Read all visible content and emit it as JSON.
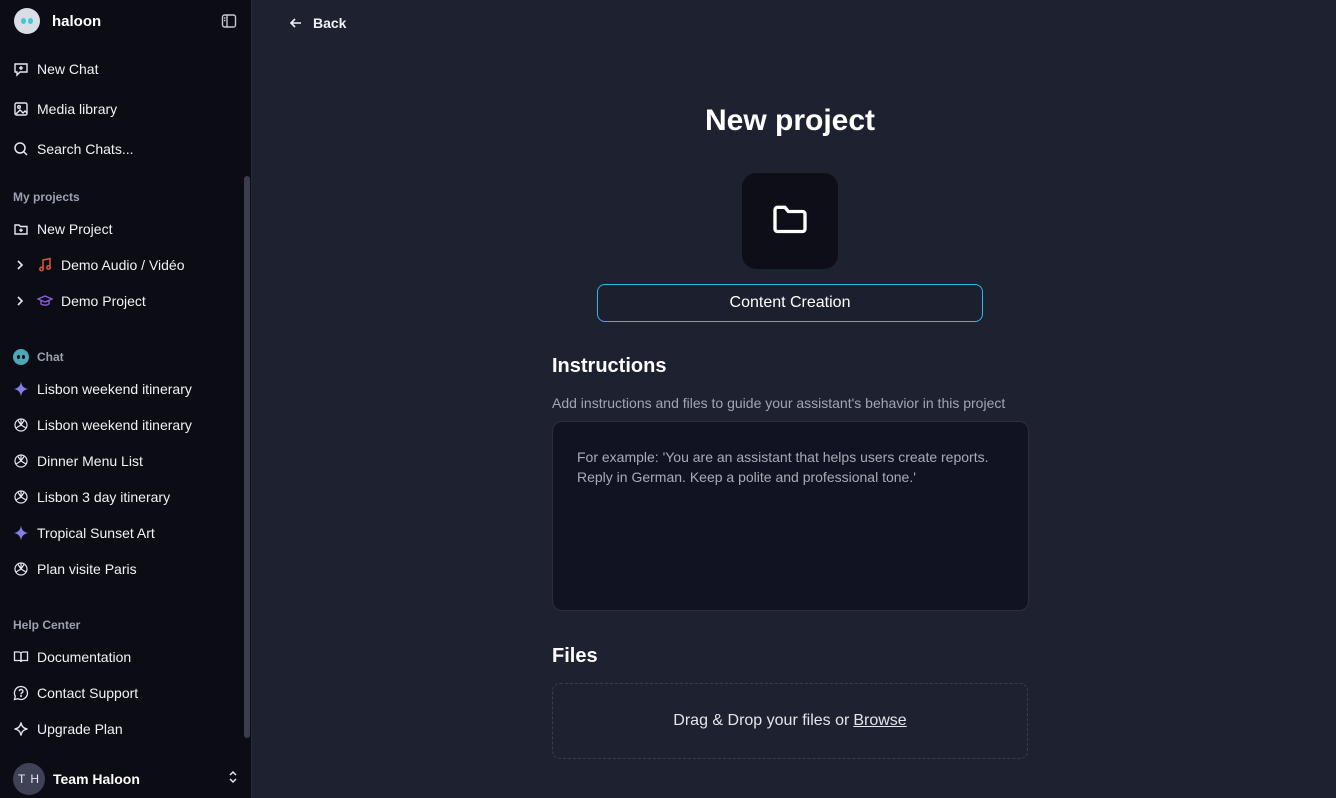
{
  "sidebar": {
    "brand_name": "haloon",
    "nav": {
      "new_chat": "New Chat",
      "media_library": "Media library",
      "search_chats": "Search Chats..."
    },
    "projects_label": "My projects",
    "new_project": "New Project",
    "projects": [
      {
        "label": "Demo Audio / Vidéo",
        "icon": "music-note-icon",
        "icon_color": "#e0533d"
      },
      {
        "label": "Demo Project",
        "icon": "graduation-cap-icon",
        "icon_color": "#8a5cd6"
      }
    ],
    "chat_label": "Chat",
    "chats": [
      {
        "label": "Lisbon weekend itinerary",
        "icon": "sparkle-icon"
      },
      {
        "label": "Lisbon weekend itinerary",
        "icon": "openai-icon"
      },
      {
        "label": "Dinner Menu List",
        "icon": "openai-icon"
      },
      {
        "label": "Lisbon 3 day itinerary",
        "icon": "openai-icon"
      },
      {
        "label": "Tropical Sunset Art",
        "icon": "sparkle-icon"
      },
      {
        "label": "Plan visite Paris",
        "icon": "openai-icon"
      }
    ],
    "help_label": "Help Center",
    "help": {
      "documentation": "Documentation",
      "contact_support": "Contact Support",
      "upgrade_plan": "Upgrade Plan"
    },
    "user": {
      "initials": "T H",
      "name": "Team Haloon"
    }
  },
  "main": {
    "back_label": "Back",
    "title": "New project",
    "project_name_value": "Content Creation",
    "instructions_title": "Instructions",
    "instructions_description": "Add instructions and files to guide your assistant's behavior in this project",
    "instructions_placeholder": "For example: 'You are an assistant that helps users create reports. Reply in German. Keep a polite and professional tone.'",
    "files_title": "Files",
    "dropzone_text": "Drag & Drop your files or",
    "browse_label": "Browse"
  },
  "colors": {
    "accent": "#2db7e8",
    "sidebar_bg": "#0b0c14",
    "main_bg": "#1e2130"
  }
}
